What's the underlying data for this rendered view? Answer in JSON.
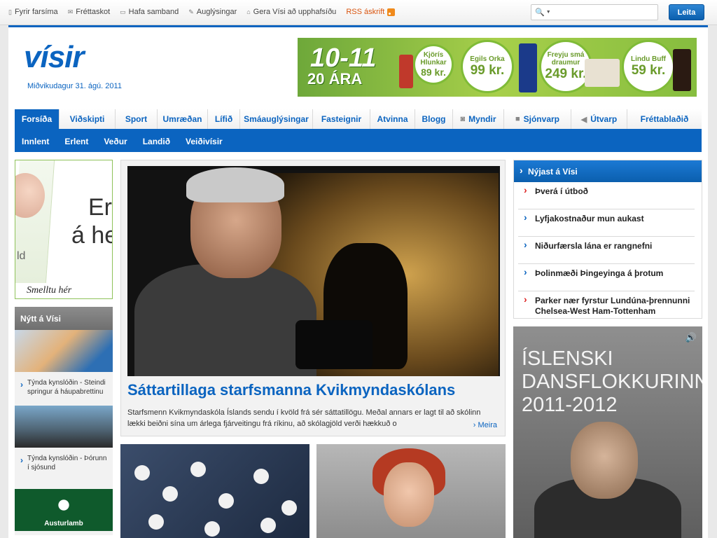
{
  "topbar": {
    "links": [
      {
        "icon": "phone-icon",
        "label": "Fyrir farsíma"
      },
      {
        "icon": "mail-icon",
        "label": "Fréttaskot"
      },
      {
        "icon": "chat-icon",
        "label": "Hafa samband"
      },
      {
        "icon": "edit-icon",
        "label": "Auglýsingar"
      },
      {
        "icon": "home-icon",
        "label": "Gera Vísi að upphafsíðu"
      }
    ],
    "rss_label": "RSS áskrift",
    "search_placeholder": "",
    "search_button": "Leita"
  },
  "header": {
    "logo": "vísir",
    "date": "Miðvikudagur 31. ágú. 2011"
  },
  "banner": {
    "brand": "10-11",
    "years": "20 ÁRA",
    "offers": [
      {
        "name": "Kjörís Hlunkar",
        "price": "89 kr."
      },
      {
        "name": "Egils Orka",
        "price": "99 kr."
      },
      {
        "name": "Freyju smá draumur",
        "price": "249 kr."
      },
      {
        "name": "Lindu Buff",
        "price": "59 kr."
      }
    ]
  },
  "nav": {
    "main": [
      "Forsíða",
      "Viðskipti",
      "Sport",
      "Umræðan",
      "Lífið",
      "Smáauglýsingar",
      "Fasteignir",
      "Atvinna",
      "Blogg",
      "Myndir",
      "Sjónvarp",
      "Útvarp",
      "Fréttablaðið"
    ],
    "sub": [
      "Innlent",
      "Erlent",
      "Veður",
      "Landið",
      "Veiðivísir"
    ]
  },
  "left_ad": {
    "line1": "Er",
    "line2": "á heim",
    "cta": "Smelltu hér",
    "side": "ld"
  },
  "nytt": {
    "title": "Nýtt á Vísi",
    "items": [
      {
        "caption": "Týnda kynslóðin - Steindi springur á háupabrettinu"
      },
      {
        "caption": "Týnda kynslóðin - Þórunn í sjósund"
      }
    ],
    "sponsor": "Austurlamb"
  },
  "featured": {
    "title": "Sáttartillaga starfsmanna Kvikmyndaskólans",
    "text": "Starfsmenn Kvikmyndaskóla Íslands sendu í kvöld frá sér sáttatillögu. Meðal annars er lagt til að skólinn lækki beiðni sína um árlega fjárveitingu frá ríkinu, að skólagjöld verði hækkuð o",
    "more": "Meira"
  },
  "newest": {
    "title": "Nýjast á Vísi",
    "items": [
      {
        "text": "Þverá í útboð"
      },
      {
        "text": "Lyfjakostnaður mun aukast"
      },
      {
        "text": "Niðurfærsla lána er rangnefni"
      },
      {
        "text": "Þolinmæði Þingeyinga á þrotum"
      },
      {
        "text": "Parker nær fyrstur Lundúna-þrennunni Chelsea-West Ham-Tottenham"
      }
    ]
  },
  "dance_ad": {
    "line1": "ÍSLENSKI",
    "line2": "DANSFLOKKURINN",
    "line3": "2011-2012"
  },
  "colors": {
    "brand_blue": "#0b64c0",
    "rss_orange": "#f08a1b"
  }
}
